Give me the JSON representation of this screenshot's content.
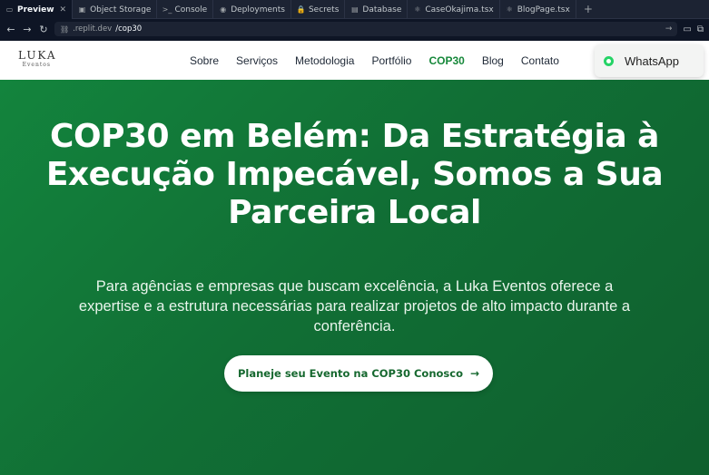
{
  "ide": {
    "tabs": [
      {
        "icon": "preview-icon",
        "glyph": "▭",
        "label": "Preview",
        "active": true,
        "closable": true
      },
      {
        "icon": "object-storage-icon",
        "glyph": "▣",
        "label": "Object Storage"
      },
      {
        "icon": "console-icon",
        "glyph": ">_",
        "label": "Console"
      },
      {
        "icon": "deployments-icon",
        "glyph": "◉",
        "label": "Deployments"
      },
      {
        "icon": "secrets-icon",
        "glyph": "🔒",
        "label": "Secrets"
      },
      {
        "icon": "database-icon",
        "glyph": "▤",
        "label": "Database"
      },
      {
        "icon": "tsx-file-icon",
        "glyph": "⚛",
        "label": "CaseOkajima.tsx"
      },
      {
        "icon": "tsx-file-icon",
        "glyph": "⚛",
        "label": "BlogPage.tsx"
      }
    ],
    "add_tab": "+",
    "url": {
      "host": ".replit.dev",
      "path": "/cop30"
    }
  },
  "site": {
    "logo": {
      "main": "LUKA",
      "sub": "Eventos"
    },
    "nav": [
      {
        "label": "Sobre"
      },
      {
        "label": "Serviços"
      },
      {
        "label": "Metodologia"
      },
      {
        "label": "Portfólio"
      },
      {
        "label": "COP30",
        "active": true
      },
      {
        "label": "Blog"
      },
      {
        "label": "Contato"
      }
    ],
    "whatsapp_label": "WhatsApp",
    "hero": {
      "title": "COP30 em Belém: Da Estratégia à Execução Impecável, Somos a Sua Parceira Local",
      "subtitle": "Para agências e empresas que buscam excelência, a Luka Eventos oferece a expertise e a estrutura necessárias para realizar projetos de alto impacto durante a conferência.",
      "cta_label": "Planeje seu Evento na COP30 Conosco"
    }
  },
  "colors": {
    "brand_green": "#16883a",
    "hero_bg": "#13843d",
    "ide_bg": "#0e1525",
    "whatsapp": "#25d366"
  }
}
